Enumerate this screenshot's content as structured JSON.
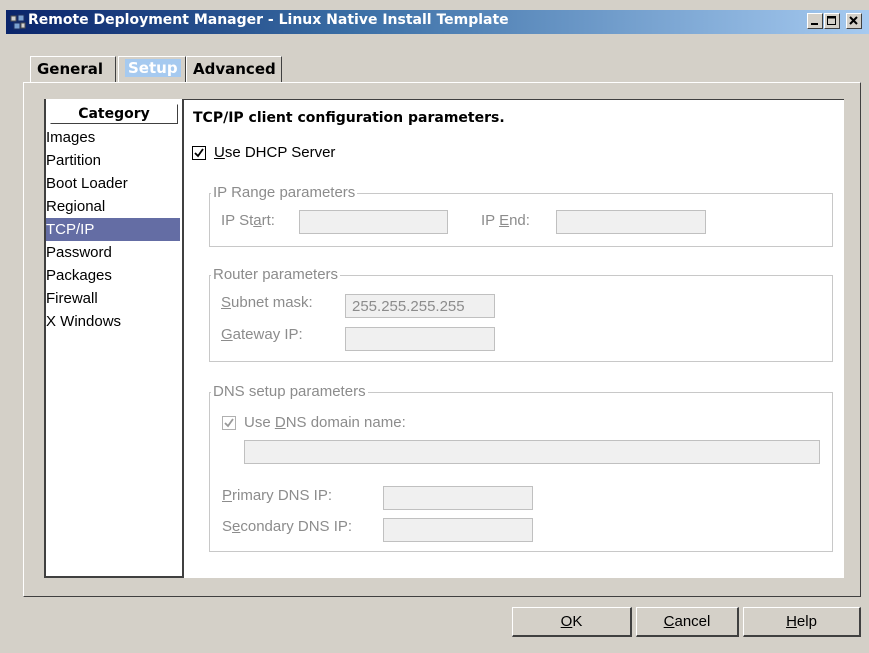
{
  "window": {
    "title": "Remote Deployment Manager - Linux Native Install Template",
    "min_glyph": "_",
    "max_glyph": "□",
    "close_glyph": "✕"
  },
  "tabs": [
    {
      "label": "General"
    },
    {
      "label": "Setup",
      "selected": true
    },
    {
      "label": "Advanced"
    }
  ],
  "category": {
    "header": "Category",
    "items": [
      "Images",
      "Partition",
      "Boot Loader",
      "Regional",
      "TCP/IP",
      "Password",
      "Packages",
      "Firewall",
      "X Windows"
    ],
    "selected": "TCP/IP"
  },
  "tcpip": {
    "heading": "TCP/IP client configuration parameters.",
    "use_dhcp": {
      "label_u": "U",
      "label_rest": "se DHCP Server",
      "checked": true
    },
    "ip_range": {
      "title": "IP Range parameters",
      "ip_start_label": "IP St",
      "ip_start_u": "a",
      "ip_start_rest": "rt:",
      "ip_start_value": "",
      "ip_end_label": "IP ",
      "ip_end_u": "E",
      "ip_end_rest": "nd:",
      "ip_end_value": ""
    },
    "router": {
      "title": "Router parameters",
      "subnet_u": "S",
      "subnet_rest": "ubnet mask:",
      "subnet_value": "255.255.255.255",
      "gateway_u": "G",
      "gateway_rest": "ateway IP:",
      "gateway_value": ""
    },
    "dns": {
      "title": "DNS setup parameters",
      "use_domain_pre": "Use ",
      "use_domain_u": "D",
      "use_domain_rest": "NS domain name:",
      "use_domain_checked": true,
      "domain_value": "",
      "primary_u": "P",
      "primary_rest": "rimary DNS IP:",
      "primary_value": "",
      "secondary_pre": "S",
      "secondary_u": "e",
      "secondary_rest": "condary DNS IP:",
      "secondary_value": ""
    }
  },
  "buttons": {
    "ok_u": "O",
    "ok_rest": "K",
    "cancel_u": "C",
    "cancel_rest": "ancel",
    "help_u": "H",
    "help_rest": "elp"
  },
  "colors": {
    "title_start": "#0a246a",
    "title_end": "#a6caf0",
    "selection": "#646da4",
    "disabled_text": "#8c8c8c"
  }
}
